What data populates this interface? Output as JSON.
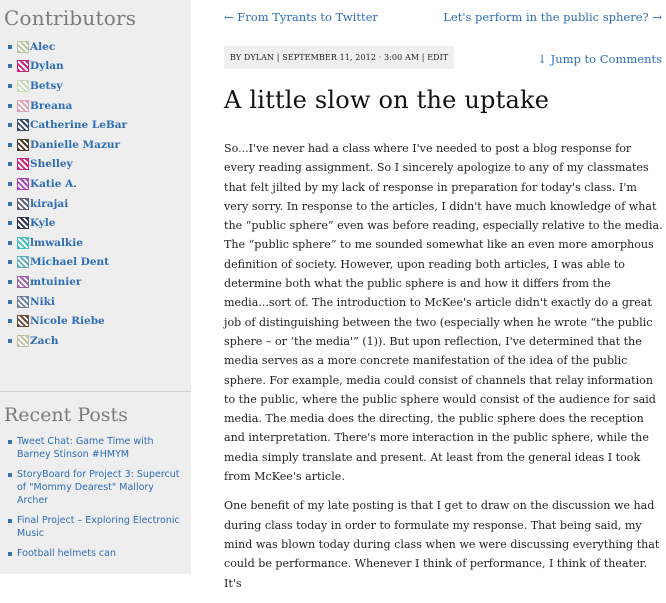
{
  "sidebar": {
    "contributors_title": "Contributors",
    "contributors": [
      {
        "name": "Alec",
        "color": "#b8c4a0"
      },
      {
        "name": "Dylan",
        "color": "#d0207a"
      },
      {
        "name": "Betsy",
        "color": "#c8d8b8"
      },
      {
        "name": "Breana",
        "color": "#e0a0b0"
      },
      {
        "name": "Catherine LeBar",
        "color": "#3a4a6a"
      },
      {
        "name": "Danielle Mazur",
        "color": "#4a3a2a"
      },
      {
        "name": "Shelley",
        "color": "#d0207a"
      },
      {
        "name": "Katie A.",
        "color": "#b040c0"
      },
      {
        "name": "kirajai",
        "color": "#606070"
      },
      {
        "name": "Kyle",
        "color": "#303050"
      },
      {
        "name": "lmwalkie",
        "color": "#40c0c0"
      },
      {
        "name": "Michael Dent",
        "color": "#60b0c0"
      },
      {
        "name": "mtuinier",
        "color": "#a060b0"
      },
      {
        "name": "Niki",
        "color": "#7080a0"
      },
      {
        "name": "Nicole Riebe",
        "color": "#6a4a3a"
      },
      {
        "name": "Zach",
        "color": "#c0c0a0"
      }
    ],
    "recent_title": "Recent Posts",
    "recent_posts": [
      "Tweet Chat: Game Time with Barney Stinson #HMYM",
      "StoryBoard for Project 3: Supercut of \"Mommy Dearest\" Mallory Archer",
      "Final Project – Exploring Electronic Music",
      "Football helmets can"
    ]
  },
  "nav": {
    "prev": "← From Tyrants to Twitter",
    "next": "Let's perform in the public sphere? →"
  },
  "post": {
    "meta": "BY DYLAN | SEPTEMBER 11, 2012 · 3:00 AM | EDIT",
    "jump": "↓ Jump to Comments",
    "title": "A little slow on the uptake",
    "paragraphs": [
      "So...I've never had a class where I've needed to post a blog response for every reading assignment. So I sincerely apologize to any of my classmates that felt jilted by my lack of response in preparation for today's class. I'm very sorry. In response to the articles, I didn't have much knowledge of what the “public sphere” even was before reading, especially relative to the media. The “public sphere” to me sounded somewhat like an even more amorphous definition of society. However, upon reading both articles, I was able to determine both what the public sphere is and how it differs from the media...sort of. The introduction to McKee's article didn't exactly do a great job of distinguishing between the two (especially when he wrote “the public sphere – or ‘the media'” (1)). But upon reflection, I've determined that the media serves as a more concrete manifestation of the idea of the public sphere. For example, media could consist of channels that relay information to the public, where the public sphere would consist of the audience for said media. The media does the directing, the public sphere does the reception and interpretation. There's more interaction in the public sphere, while the media simply translate and present. At least from the general ideas I took from McKee's article.",
      "One benefit of my late posting is that I get to draw on the discussion we had during class today in order to formulate my response. That being said, my mind was blown today during class when we were discussing everything that could be performance. Whenever I think of performance, I think of theater. It's"
    ]
  }
}
